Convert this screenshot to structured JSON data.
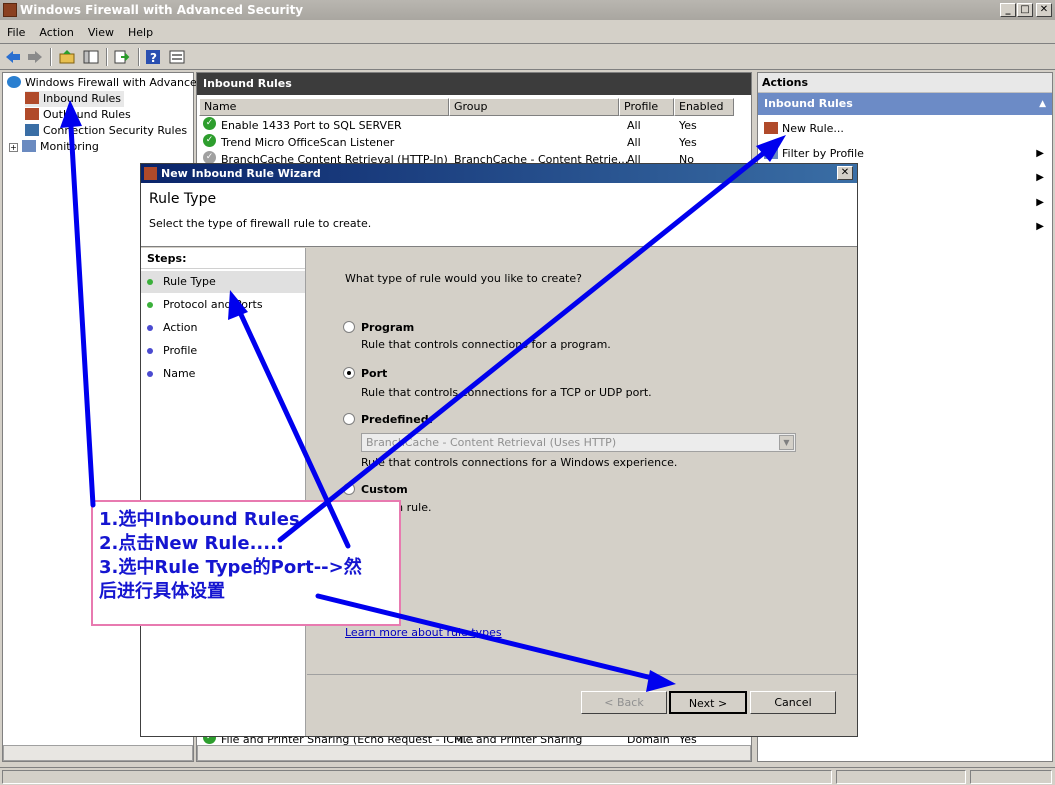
{
  "window": {
    "title": "Windows Firewall with Advanced Security"
  },
  "menu": [
    "File",
    "Action",
    "View",
    "Help"
  ],
  "tree": {
    "root": "Windows Firewall with Advanced S",
    "items": [
      "Inbound Rules",
      "Outbound Rules",
      "Connection Security Rules",
      "Monitoring"
    ],
    "expand_glyph": "+"
  },
  "center": {
    "title": "Inbound Rules",
    "columns": [
      "Name",
      "Group",
      "Profile",
      "Enabled"
    ],
    "rows": [
      {
        "name": "Enable 1433 Port to SQL SERVER",
        "group": "",
        "profile": "All",
        "enabled": "Yes"
      },
      {
        "name": "Trend Micro OfficeScan Listener",
        "group": "",
        "profile": "All",
        "enabled": "Yes"
      },
      {
        "name": "BranchCache Content Retrieval (HTTP-In)",
        "group": "BranchCache - Content Retrie...",
        "profile": "All",
        "enabled": "No"
      },
      {
        "name": "File and Printer Sharing (Echo Request - ICM...",
        "group": "File and Printer Sharing",
        "profile": "Domain",
        "enabled": "Yes"
      }
    ]
  },
  "actions": {
    "title": "Actions",
    "section": "Inbound Rules",
    "items": [
      "New Rule...",
      "Filter by Profile"
    ]
  },
  "wizard": {
    "title": "New Inbound Rule Wizard",
    "heading": "Rule Type",
    "subheading": "Select the type of firewall rule to create.",
    "steps_label": "Steps:",
    "steps": [
      "Rule Type",
      "Protocol and Ports",
      "Action",
      "Profile",
      "Name"
    ],
    "question": "What type of rule would you like to create?",
    "options": [
      {
        "label": "Program",
        "desc": "Rule that controls connections for a program."
      },
      {
        "label": "Port",
        "desc": "Rule that controls connections for a TCP or UDP port."
      },
      {
        "label": "Predefined:",
        "desc": "Rule that controls connections for a Windows experience."
      },
      {
        "label": "Custom",
        "desc": "Custom rule."
      }
    ],
    "selected": "Port",
    "predefined_value": "BranchCache - Content Retrieval (Uses HTTP)",
    "learn_more": "Learn more about rule types",
    "back": "< Back",
    "next": "Next >",
    "cancel": "Cancel"
  },
  "annotation": [
    "1.选中Inbound Rules",
    "2.点击New Rule.....",
    "3.选中Rule Type的Port-->然",
    "后进行具体设置"
  ],
  "colors": {
    "annotation_text": "#1515d0",
    "arrow": "#0000ee",
    "annotation_border": "#e87ab0",
    "wizard_title": "#0a246a",
    "actions_header": "#6c8bc6"
  }
}
